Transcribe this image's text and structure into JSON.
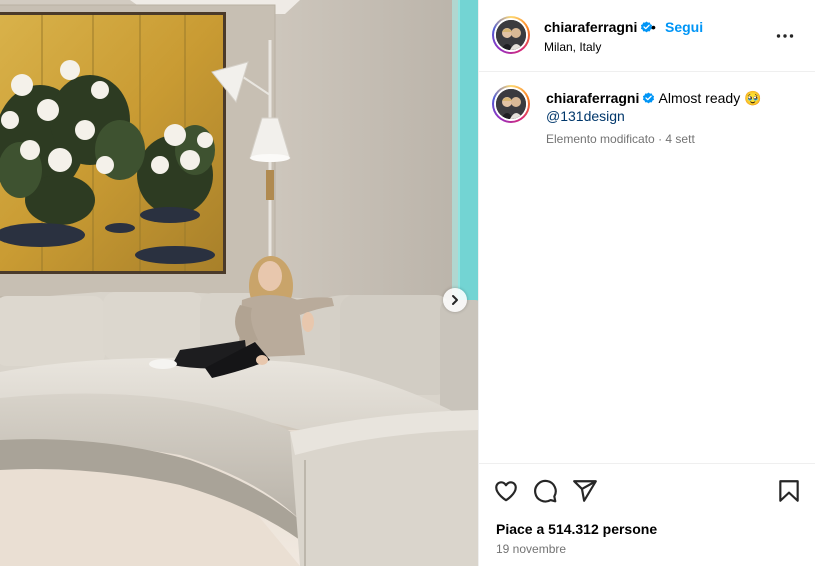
{
  "post": {
    "username": "chiaraferragni",
    "verified": true,
    "follow_label": "Segui",
    "separator": "•",
    "location": "Milan, Italy"
  },
  "caption": {
    "username": "chiaraferragni",
    "text": "Almost ready 🥹",
    "mention": "@131design",
    "edited_label": "Elemento modificato",
    "time_ago": "4 sett"
  },
  "actions": {
    "icons": [
      "heart-icon",
      "comment-icon",
      "share-icon",
      "bookmark-icon"
    ]
  },
  "stats": {
    "likes_text": "Piace a 514.312 persone",
    "date": "19 novembre"
  },
  "colors": {
    "link_blue": "#0095f6",
    "mention_blue": "#00376b",
    "muted_grey": "#737373",
    "verified_blue": "#0095f6"
  }
}
